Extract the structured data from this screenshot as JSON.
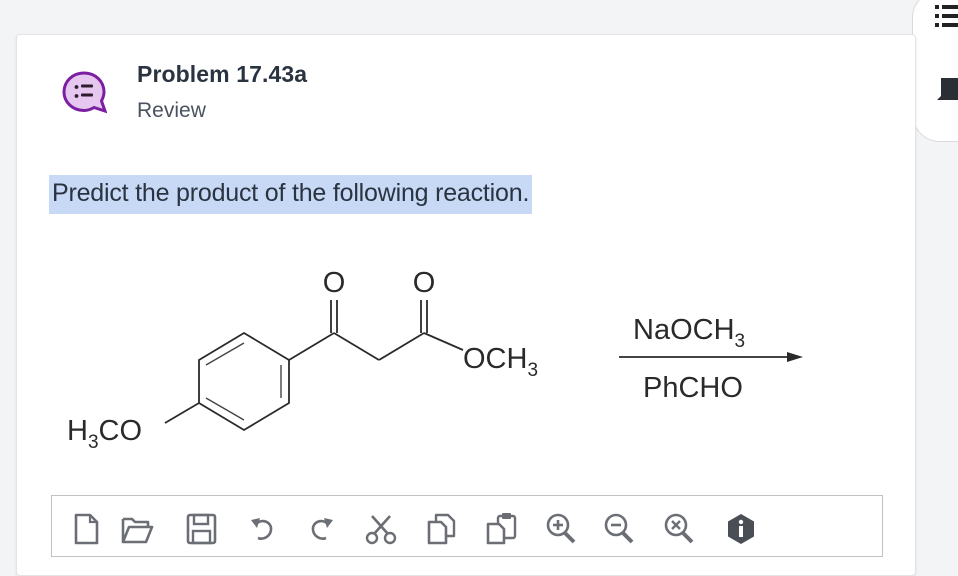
{
  "problem": {
    "title": "Problem 17.43a",
    "subtitle": "Review",
    "question": "Predict the product of the following reaction."
  },
  "reaction": {
    "carbonyl_oxygen_1": "O",
    "carbonyl_oxygen_2": "O",
    "ester_group_main": "OCH",
    "ester_group_sub": "3",
    "methoxy_h": "H",
    "methoxy_sub": "3",
    "methoxy_co": "CO",
    "reagent_main": "NaOCH",
    "reagent_sub": "3",
    "second_reagent": "PhCHO"
  },
  "toolbar": {
    "buttons": [
      "new-file-icon",
      "open-file-icon",
      "save-icon",
      "undo-icon",
      "redo-icon",
      "cut-icon",
      "copy-icon",
      "paste-icon",
      "zoom-in-icon",
      "zoom-out-icon",
      "zoom-reset-icon",
      "info-icon"
    ]
  },
  "colors": {
    "highlight": "#c8d9f6",
    "brand_purple": "#7b1fa2",
    "bubble_fill": "#e6c7ef",
    "text_dark": "#2a3441"
  }
}
